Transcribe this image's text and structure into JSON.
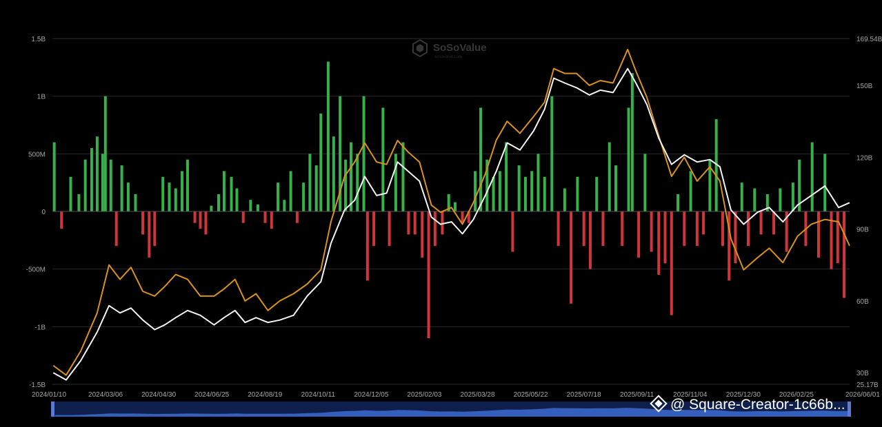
{
  "watermark": {
    "brand": "SoSoValue",
    "tagline": "sosovalue.com"
  },
  "credit": {
    "text": "@ Square-Creator-1c66b..."
  },
  "colors": {
    "background": "#000000",
    "inflow": "#36b14b",
    "outflow": "#d0353b",
    "price_line": "#f4f4f4",
    "assets_line": "#d9921c",
    "grid": "#2a2a2a",
    "axis_text": "#a6a6a6",
    "navigator": "#1a3c8c"
  },
  "chart_data": {
    "type": "bar",
    "x_ticks": [
      "2024/01/10",
      "2024/03/06",
      "2024/04/30",
      "2024/06/25",
      "2024/08/19",
      "2024/10/11",
      "2024/12/05",
      "2025/02/03",
      "2025/03/28",
      "2025/05/22",
      "2025/07/18",
      "2025/09/11",
      "2025/11/04",
      "2025/12/30",
      "2026/02/25",
      "2026/06/01"
    ],
    "y_left_ticks": [
      "1.5B",
      "1B",
      "500M",
      "0",
      "-500M",
      "-1B",
      "-1.5B"
    ],
    "y_left_range": [
      -1500000000,
      1500000000
    ],
    "y_right_ticks": [
      "169.54B",
      "150B",
      "120B",
      "90B",
      "60B",
      "30B",
      "25.17B"
    ],
    "y_right_range": [
      25.17,
      169.54
    ],
    "x_range": [
      "2024-01-10",
      "2026-06-01"
    ],
    "grid": true,
    "series": [
      {
        "kind": "bar",
        "axis": "left",
        "points": [
          [
            "2024-01-12",
            600000000
          ],
          [
            "2024-01-20",
            -150000000
          ],
          [
            "2024-01-30",
            300000000
          ],
          [
            "2024-02-08",
            150000000
          ],
          [
            "2024-02-15",
            450000000
          ],
          [
            "2024-02-22",
            550000000
          ],
          [
            "2024-02-28",
            650000000
          ],
          [
            "2024-03-05",
            500000000
          ],
          [
            "2024-03-08",
            1000000000
          ],
          [
            "2024-03-14",
            450000000
          ],
          [
            "2024-03-20",
            -300000000
          ],
          [
            "2024-03-26",
            400000000
          ],
          [
            "2024-04-02",
            250000000
          ],
          [
            "2024-04-10",
            150000000
          ],
          [
            "2024-04-18",
            -200000000
          ],
          [
            "2024-04-25",
            -400000000
          ],
          [
            "2024-05-01",
            -300000000
          ],
          [
            "2024-05-10",
            300000000
          ],
          [
            "2024-05-17",
            250000000
          ],
          [
            "2024-05-24",
            200000000
          ],
          [
            "2024-05-31",
            350000000
          ],
          [
            "2024-06-06",
            450000000
          ],
          [
            "2024-06-14",
            -100000000
          ],
          [
            "2024-06-20",
            -150000000
          ],
          [
            "2024-06-26",
            -200000000
          ],
          [
            "2024-07-02",
            50000000
          ],
          [
            "2024-07-10",
            150000000
          ],
          [
            "2024-07-16",
            350000000
          ],
          [
            "2024-07-24",
            300000000
          ],
          [
            "2024-07-30",
            200000000
          ],
          [
            "2024-08-06",
            -100000000
          ],
          [
            "2024-08-14",
            100000000
          ],
          [
            "2024-08-22",
            60000000
          ],
          [
            "2024-08-30",
            -100000000
          ],
          [
            "2024-09-06",
            -150000000
          ],
          [
            "2024-09-13",
            250000000
          ],
          [
            "2024-09-20",
            100000000
          ],
          [
            "2024-09-27",
            350000000
          ],
          [
            "2024-10-04",
            -100000000
          ],
          [
            "2024-10-11",
            250000000
          ],
          [
            "2024-10-18",
            500000000
          ],
          [
            "2024-10-25",
            400000000
          ],
          [
            "2024-10-30",
            850000000
          ],
          [
            "2024-11-07",
            1300000000
          ],
          [
            "2024-11-13",
            650000000
          ],
          [
            "2024-11-20",
            1000000000
          ],
          [
            "2024-11-26",
            450000000
          ],
          [
            "2024-12-02",
            600000000
          ],
          [
            "2024-12-09",
            500000000
          ],
          [
            "2024-12-16",
            1000000000
          ],
          [
            "2024-12-20",
            -600000000
          ],
          [
            "2024-12-27",
            -300000000
          ],
          [
            "2025-01-06",
            900000000
          ],
          [
            "2025-01-13",
            -300000000
          ],
          [
            "2025-01-20",
            500000000
          ],
          [
            "2025-01-28",
            600000000
          ],
          [
            "2025-02-03",
            -200000000
          ],
          [
            "2025-02-10",
            -200000000
          ],
          [
            "2025-02-18",
            -400000000
          ],
          [
            "2025-02-25",
            -1100000000
          ],
          [
            "2025-03-04",
            -300000000
          ],
          [
            "2025-03-12",
            -200000000
          ],
          [
            "2025-03-19",
            150000000
          ],
          [
            "2025-03-26",
            80000000
          ],
          [
            "2025-04-03",
            -100000000
          ],
          [
            "2025-04-10",
            -100000000
          ],
          [
            "2025-04-17",
            350000000
          ],
          [
            "2025-04-23",
            900000000
          ],
          [
            "2025-04-30",
            450000000
          ],
          [
            "2025-05-07",
            300000000
          ],
          [
            "2025-05-14",
            350000000
          ],
          [
            "2025-05-21",
            600000000
          ],
          [
            "2025-05-28",
            -350000000
          ],
          [
            "2025-06-04",
            400000000
          ],
          [
            "2025-06-11",
            300000000
          ],
          [
            "2025-06-18",
            350000000
          ],
          [
            "2025-06-25",
            500000000
          ],
          [
            "2025-07-02",
            300000000
          ],
          [
            "2025-07-10",
            1000000000
          ],
          [
            "2025-07-17",
            -300000000
          ],
          [
            "2025-07-24",
            200000000
          ],
          [
            "2025-07-31",
            -800000000
          ],
          [
            "2025-08-07",
            300000000
          ],
          [
            "2025-08-14",
            -300000000
          ],
          [
            "2025-08-21",
            -500000000
          ],
          [
            "2025-08-28",
            300000000
          ],
          [
            "2025-09-04",
            -300000000
          ],
          [
            "2025-09-11",
            600000000
          ],
          [
            "2025-09-18",
            400000000
          ],
          [
            "2025-09-25",
            -300000000
          ],
          [
            "2025-10-02",
            900000000
          ],
          [
            "2025-10-06",
            1200000000
          ],
          [
            "2025-10-13",
            -400000000
          ],
          [
            "2025-10-20",
            500000000
          ],
          [
            "2025-10-27",
            -350000000
          ],
          [
            "2025-11-04",
            -550000000
          ],
          [
            "2025-11-11",
            -450000000
          ],
          [
            "2025-11-18",
            -900000000
          ],
          [
            "2025-11-25",
            150000000
          ],
          [
            "2025-12-02",
            -300000000
          ],
          [
            "2025-12-09",
            350000000
          ],
          [
            "2025-12-16",
            -300000000
          ],
          [
            "2025-12-23",
            -200000000
          ],
          [
            "2025-12-30",
            450000000
          ],
          [
            "2026-01-06",
            800000000
          ],
          [
            "2026-01-13",
            -300000000
          ],
          [
            "2026-01-20",
            -600000000
          ],
          [
            "2026-01-27",
            -450000000
          ],
          [
            "2026-02-03",
            250000000
          ],
          [
            "2026-02-10",
            -300000000
          ],
          [
            "2026-02-17",
            200000000
          ],
          [
            "2026-02-24",
            -200000000
          ],
          [
            "2026-03-03",
            150000000
          ],
          [
            "2026-03-10",
            -200000000
          ],
          [
            "2026-03-17",
            200000000
          ],
          [
            "2026-03-24",
            -350000000
          ],
          [
            "2026-03-31",
            250000000
          ],
          [
            "2026-04-07",
            450000000
          ],
          [
            "2026-04-14",
            -300000000
          ],
          [
            "2026-04-21",
            600000000
          ],
          [
            "2026-04-28",
            -400000000
          ],
          [
            "2026-05-05",
            500000000
          ],
          [
            "2026-05-12",
            -500000000
          ],
          [
            "2026-05-19",
            -450000000
          ],
          [
            "2026-05-26",
            -750000000
          ]
        ]
      },
      {
        "kind": "line",
        "axis": "right",
        "color": "#f4f4f4",
        "points": [
          [
            "2024-01-11",
            30
          ],
          [
            "2024-01-25",
            27
          ],
          [
            "2024-02-10",
            35
          ],
          [
            "2024-02-28",
            47
          ],
          [
            "2024-03-12",
            58
          ],
          [
            "2024-03-24",
            55
          ],
          [
            "2024-04-05",
            57
          ],
          [
            "2024-04-18",
            52
          ],
          [
            "2024-05-01",
            48
          ],
          [
            "2024-05-12",
            50
          ],
          [
            "2024-05-24",
            53
          ],
          [
            "2024-06-06",
            56
          ],
          [
            "2024-06-20",
            54
          ],
          [
            "2024-07-05",
            50
          ],
          [
            "2024-07-16",
            53
          ],
          [
            "2024-07-28",
            56
          ],
          [
            "2024-08-08",
            51
          ],
          [
            "2024-08-20",
            53
          ],
          [
            "2024-09-02",
            51
          ],
          [
            "2024-09-15",
            52
          ],
          [
            "2024-09-30",
            54
          ],
          [
            "2024-10-15",
            62
          ],
          [
            "2024-10-30",
            68
          ],
          [
            "2024-11-10",
            84
          ],
          [
            "2024-11-25",
            98
          ],
          [
            "2024-12-06",
            102
          ],
          [
            "2024-12-17",
            112
          ],
          [
            "2024-12-30",
            104
          ],
          [
            "2025-01-10",
            105
          ],
          [
            "2025-01-22",
            118
          ],
          [
            "2025-02-03",
            114
          ],
          [
            "2025-02-15",
            110
          ],
          [
            "2025-02-28",
            95
          ],
          [
            "2025-03-10",
            92
          ],
          [
            "2025-03-22",
            93
          ],
          [
            "2025-04-03",
            88
          ],
          [
            "2025-04-15",
            94
          ],
          [
            "2025-04-28",
            104
          ],
          [
            "2025-05-10",
            114
          ],
          [
            "2025-05-22",
            126
          ],
          [
            "2025-06-05",
            123
          ],
          [
            "2025-06-20",
            131
          ],
          [
            "2025-07-02",
            140
          ],
          [
            "2025-07-12",
            153
          ],
          [
            "2025-07-24",
            151
          ],
          [
            "2025-08-06",
            149
          ],
          [
            "2025-08-20",
            146
          ],
          [
            "2025-09-01",
            148
          ],
          [
            "2025-09-15",
            147
          ],
          [
            "2025-10-01",
            157
          ],
          [
            "2025-10-10",
            151
          ],
          [
            "2025-10-22",
            142
          ],
          [
            "2025-11-04",
            128
          ],
          [
            "2025-11-18",
            117
          ],
          [
            "2025-12-02",
            121
          ],
          [
            "2025-12-16",
            118
          ],
          [
            "2025-12-30",
            119
          ],
          [
            "2026-01-10",
            116
          ],
          [
            "2026-01-22",
            98
          ],
          [
            "2026-02-05",
            92
          ],
          [
            "2026-02-20",
            97
          ],
          [
            "2026-03-05",
            99
          ],
          [
            "2026-03-20",
            93
          ],
          [
            "2026-04-05",
            100
          ],
          [
            "2026-04-20",
            104
          ],
          [
            "2026-05-05",
            108
          ],
          [
            "2026-05-20",
            99
          ],
          [
            "2026-06-01",
            101
          ]
        ]
      },
      {
        "kind": "line",
        "axis": "right",
        "color": "#d9921c",
        "points": [
          [
            "2024-01-11",
            33
          ],
          [
            "2024-01-25",
            29
          ],
          [
            "2024-02-10",
            39
          ],
          [
            "2024-02-28",
            55
          ],
          [
            "2024-03-12",
            75
          ],
          [
            "2024-03-24",
            69
          ],
          [
            "2024-04-05",
            74
          ],
          [
            "2024-04-18",
            64
          ],
          [
            "2024-05-01",
            62
          ],
          [
            "2024-05-12",
            66
          ],
          [
            "2024-05-24",
            71
          ],
          [
            "2024-06-06",
            69
          ],
          [
            "2024-06-20",
            62
          ],
          [
            "2024-07-05",
            62
          ],
          [
            "2024-07-16",
            65
          ],
          [
            "2024-07-28",
            69
          ],
          [
            "2024-08-08",
            60
          ],
          [
            "2024-08-20",
            63
          ],
          [
            "2024-09-02",
            56
          ],
          [
            "2024-09-15",
            60
          ],
          [
            "2024-09-30",
            63
          ],
          [
            "2024-10-15",
            67
          ],
          [
            "2024-10-30",
            73
          ],
          [
            "2024-11-10",
            93
          ],
          [
            "2024-11-25",
            112
          ],
          [
            "2024-12-06",
            118
          ],
          [
            "2024-12-17",
            126
          ],
          [
            "2024-12-30",
            118
          ],
          [
            "2025-01-10",
            117
          ],
          [
            "2025-01-22",
            127
          ],
          [
            "2025-02-03",
            122
          ],
          [
            "2025-02-15",
            118
          ],
          [
            "2025-02-28",
            100
          ],
          [
            "2025-03-10",
            97
          ],
          [
            "2025-03-22",
            99
          ],
          [
            "2025-04-03",
            92
          ],
          [
            "2025-04-15",
            101
          ],
          [
            "2025-04-28",
            113
          ],
          [
            "2025-05-10",
            127
          ],
          [
            "2025-05-22",
            135
          ],
          [
            "2025-06-05",
            130
          ],
          [
            "2025-06-20",
            137
          ],
          [
            "2025-07-02",
            143
          ],
          [
            "2025-07-12",
            157
          ],
          [
            "2025-07-24",
            155
          ],
          [
            "2025-08-06",
            155
          ],
          [
            "2025-08-20",
            150
          ],
          [
            "2025-09-01",
            152
          ],
          [
            "2025-09-15",
            151
          ],
          [
            "2025-10-01",
            165
          ],
          [
            "2025-10-10",
            156
          ],
          [
            "2025-10-22",
            145
          ],
          [
            "2025-11-04",
            129
          ],
          [
            "2025-11-18",
            112
          ],
          [
            "2025-12-02",
            120
          ],
          [
            "2025-12-16",
            110
          ],
          [
            "2025-12-30",
            116
          ],
          [
            "2026-01-10",
            110
          ],
          [
            "2026-01-22",
            86
          ],
          [
            "2026-02-05",
            73
          ],
          [
            "2026-02-20",
            78
          ],
          [
            "2026-03-05",
            82
          ],
          [
            "2026-03-20",
            76
          ],
          [
            "2026-04-05",
            87
          ],
          [
            "2026-04-20",
            92
          ],
          [
            "2026-05-05",
            94
          ],
          [
            "2026-05-20",
            93
          ],
          [
            "2026-06-01",
            83
          ]
        ]
      }
    ]
  }
}
